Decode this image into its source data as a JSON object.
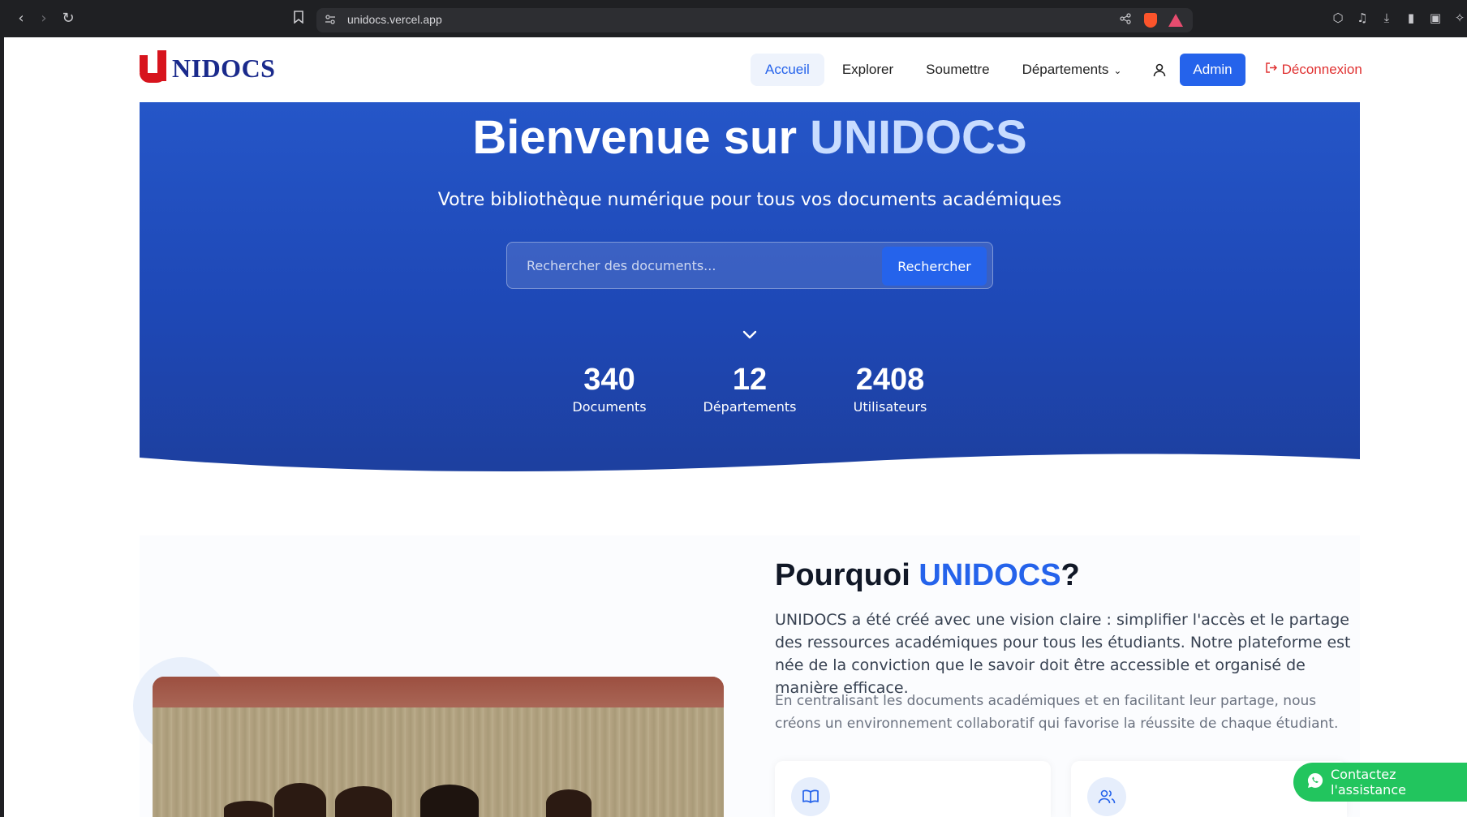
{
  "browser": {
    "url": "unidocs.vercel.app"
  },
  "header": {
    "logo_text": "NIDOCS",
    "nav": [
      {
        "label": "Accueil",
        "active": true
      },
      {
        "label": "Explorer"
      },
      {
        "label": "Soumettre"
      },
      {
        "label": "Départements"
      }
    ],
    "admin_label": "Admin",
    "logout_label": "Déconnexion"
  },
  "hero": {
    "title_prefix": "Bienvenue sur ",
    "title_accent": "UNIDOCS",
    "subtitle": "Votre bibliothèque numérique pour tous vos documents académiques",
    "search_placeholder": "Rechercher des documents...",
    "search_button": "Rechercher",
    "stats": [
      {
        "value": "340",
        "label": "Documents"
      },
      {
        "value": "12",
        "label": "Départements"
      },
      {
        "value": "2408",
        "label": "Utilisateurs"
      }
    ]
  },
  "about": {
    "title_prefix": "Pourquoi ",
    "title_accent": "UNIDOCS",
    "title_suffix": "?",
    "paragraph1": "UNIDOCS a été créé avec une vision claire : simplifier l'accès et le partage des ressources académiques pour tous les étudiants. Notre plateforme est née de la conviction que le savoir doit être accessible et organisé de manière efficace.",
    "paragraph2": "En centralisant les documents académiques et en facilitant leur partage, nous créons un environnement collaboratif qui favorise la réussite de chaque étudiant."
  },
  "assist": {
    "label": "Contactez l'assistance"
  },
  "colors": {
    "primary": "#2563eb",
    "hero_bg": "#1e48b6",
    "logo_red": "#d7141d",
    "logo_blue": "#1a2a8c",
    "logout_red": "#e03131",
    "assist_green": "#22c55e"
  }
}
